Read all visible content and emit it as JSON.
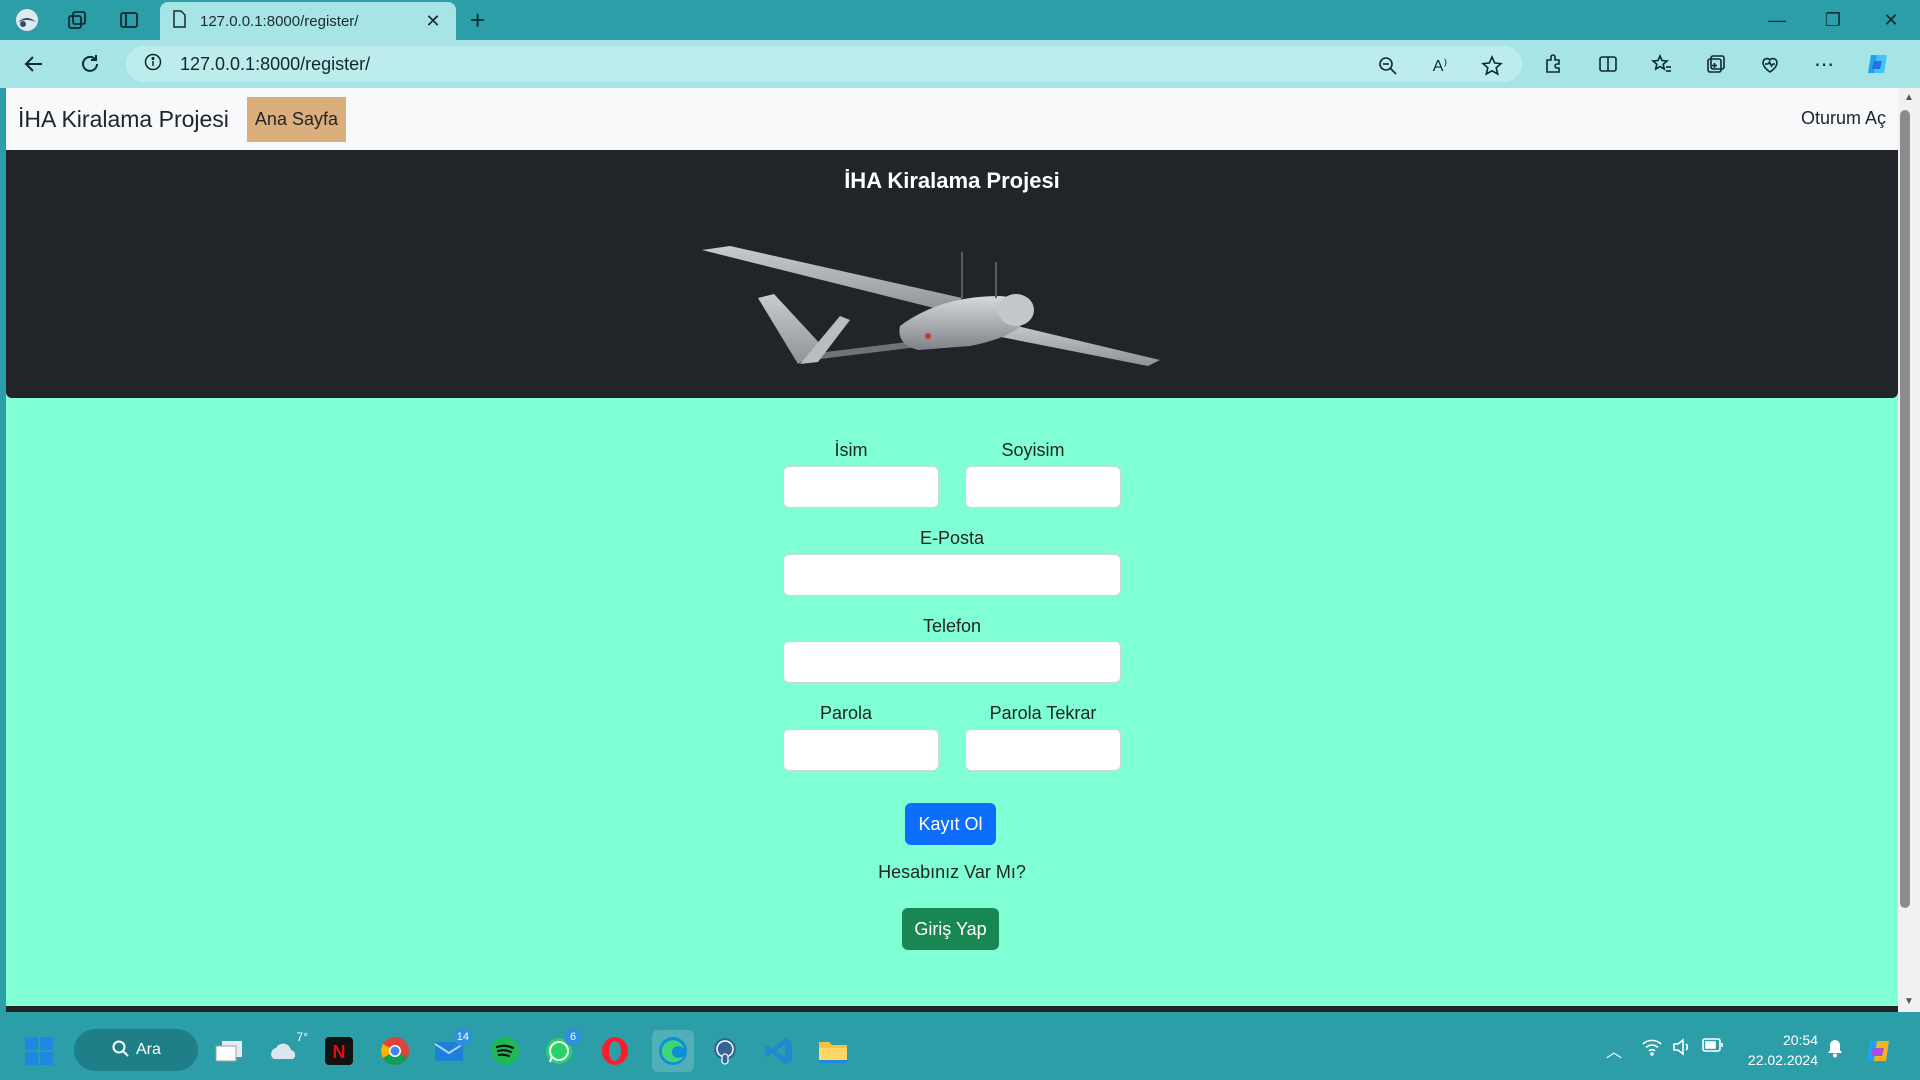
{
  "browser": {
    "tab_title": "127.0.0.1:8000/register/",
    "tab_close": "✕",
    "new_tab": "+",
    "url": "127.0.0.1:8000/register/"
  },
  "site": {
    "brand": "İHA Kiralama Projesi",
    "nav_home": "Ana Sayfa",
    "nav_login": "Oturum Aç",
    "hero_title": "İHA Kiralama Projesi"
  },
  "form": {
    "first_name_label": "İsim",
    "last_name_label": "Soyisim",
    "email_label": "E-Posta",
    "phone_label": "Telefon",
    "password_label": "Parola",
    "password_repeat_label": "Parola Tekrar",
    "first_name_value": "",
    "last_name_value": "",
    "email_value": "",
    "phone_value": "",
    "password_value": "",
    "password_repeat_value": "",
    "register_button": "Kayıt Ol",
    "have_account_text": "Hesabınız Var Mı?",
    "login_button": "Giriş Yap"
  },
  "taskbar": {
    "search_label": "Ara",
    "weather": "7°",
    "mail_badge": "14",
    "whatsapp_badge": "6",
    "time": "20:54",
    "date": "22.02.2024"
  },
  "colors": {
    "page_bg": "#80ffd4",
    "hero_bg": "#212529",
    "home_link_bg": "#dbae7c",
    "register_btn": "#0d6efd",
    "login_btn": "#198754",
    "browser_chrome": "#2b9ea8",
    "address_bar": "#a6e4e6"
  },
  "icons": [
    "profile-icon",
    "workspaces-icon",
    "tab-actions-icon",
    "page-icon",
    "back-icon",
    "refresh-icon",
    "info-icon",
    "zoom-icon",
    "read-aloud-icon",
    "favorite-star-icon",
    "extensions-icon",
    "split-screen-icon",
    "favorites-icon",
    "collections-icon",
    "browser-essentials-icon",
    "more-icon",
    "copilot-icon",
    "windows-start-icon",
    "search-icon",
    "task-view-icon",
    "weather-icon",
    "netflix-icon",
    "chrome-icon",
    "mail-icon",
    "spotify-icon",
    "whatsapp-icon",
    "opera-icon",
    "edge-icon",
    "postgres-icon",
    "vscode-icon",
    "file-explorer-icon",
    "wifi-icon",
    "volume-icon",
    "battery-icon",
    "notification-icon"
  ]
}
